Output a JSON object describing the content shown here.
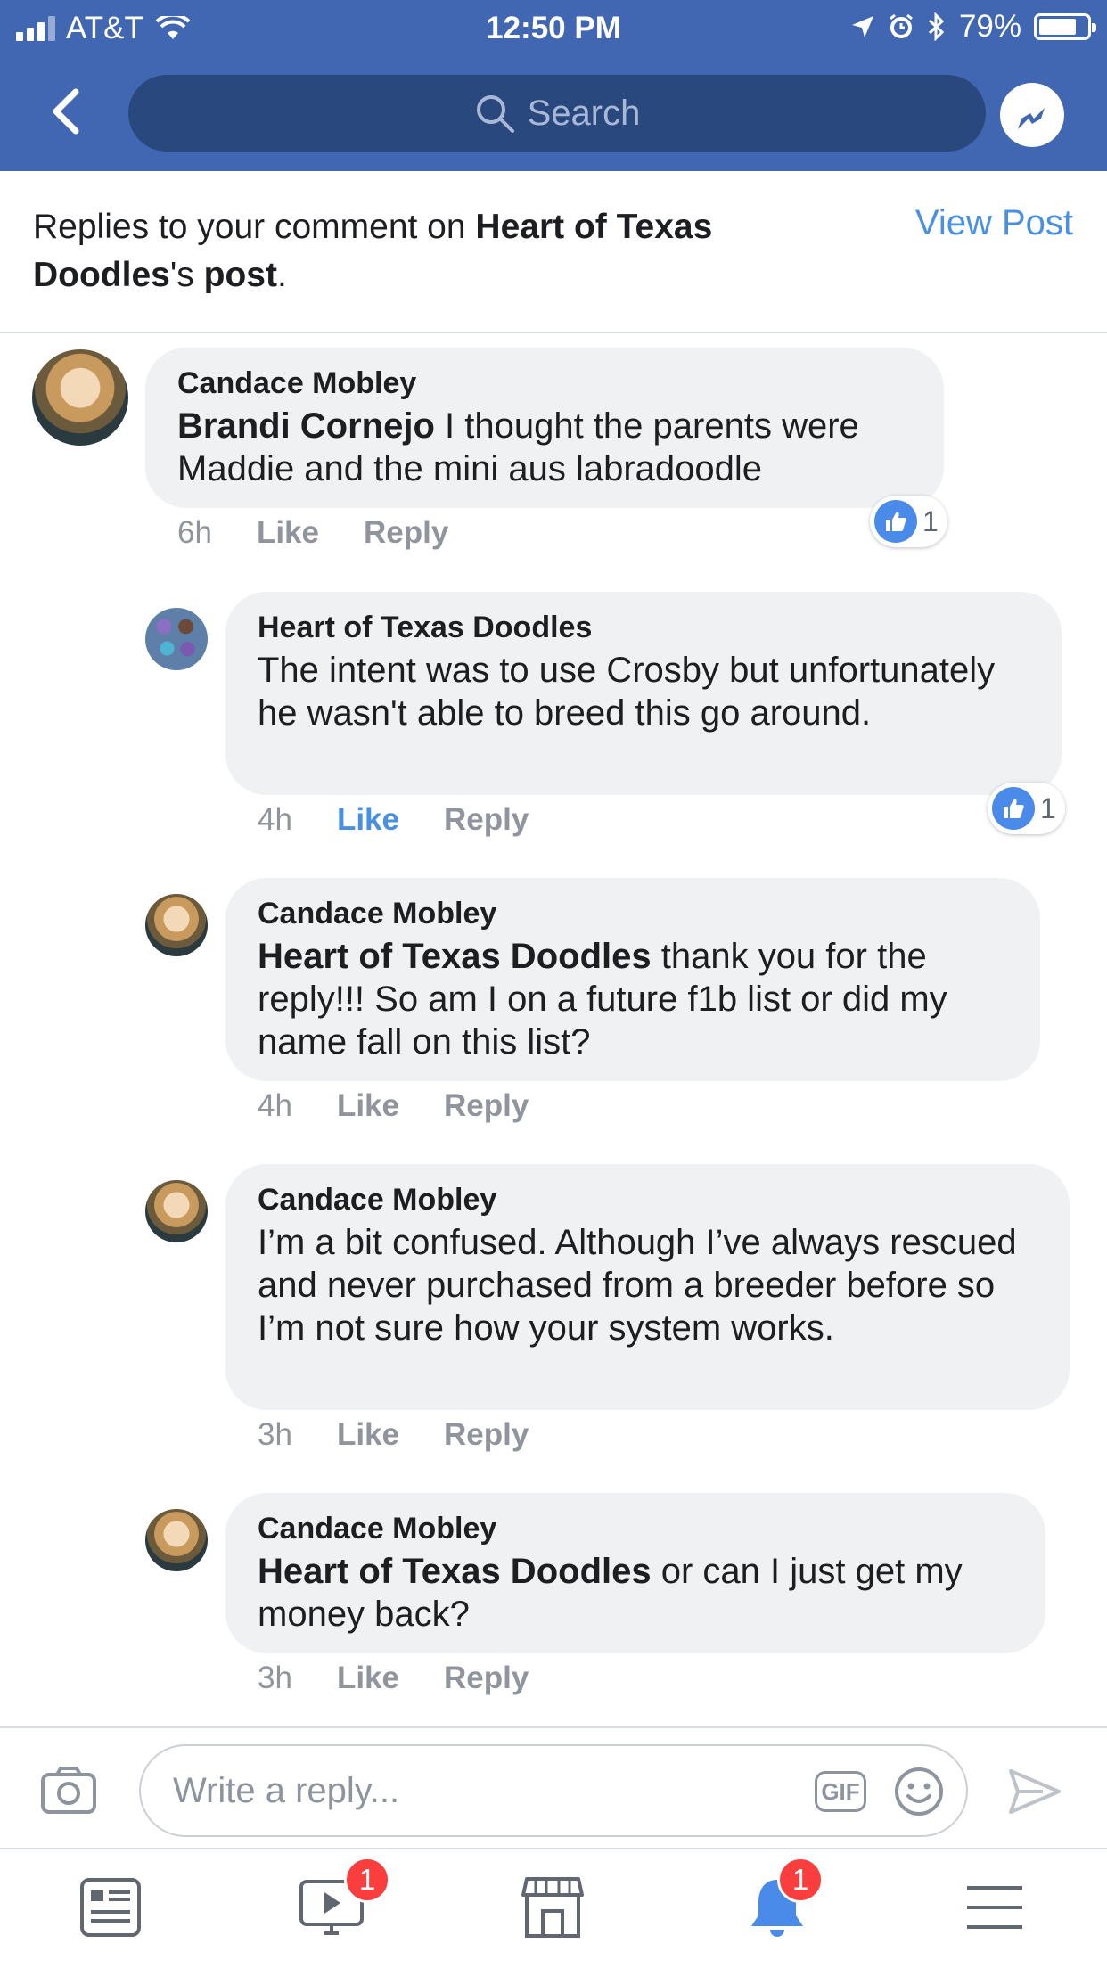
{
  "status_bar": {
    "carrier": "AT&T",
    "time": "12:50 PM",
    "battery_percent": "79%",
    "battery_level": 0.79
  },
  "nav": {
    "search_placeholder": "Search"
  },
  "notice": {
    "prefix": "Replies to your comment on ",
    "page_name": "Heart of Texas Doodles",
    "possessive": "'s ",
    "post_word": "post",
    "period": ".",
    "view_post": "View Post"
  },
  "comments": [
    {
      "author": "Candace Mobley",
      "mention": "Brandi Cornejo",
      "text": " I thought the parents were Maddie and the mini aus labradoodle",
      "time": "6h",
      "like": "Like",
      "reply": "Reply",
      "liked": false,
      "reaction_count": "1"
    },
    {
      "author": "Heart of Texas Doodles",
      "mention": "",
      "text": "The intent was to use Crosby but unfortunately he wasn't able to breed this go around.",
      "time": "4h",
      "like": "Like",
      "reply": "Reply",
      "liked": true,
      "reaction_count": "1"
    },
    {
      "author": "Candace Mobley",
      "mention": "Heart of Texas Doodles",
      "text": " thank you for the reply!!! So am I on a future f1b list or did my name fall on this list?",
      "time": "4h",
      "like": "Like",
      "reply": "Reply",
      "liked": false
    },
    {
      "author": "Candace Mobley",
      "mention": "",
      "text": "I’m a bit confused. Although I’ve  always rescued and never purchased from a breeder before so I’m not sure how your system works.",
      "time": "3h",
      "like": "Like",
      "reply": "Reply",
      "liked": false
    },
    {
      "author": "Candace Mobley",
      "mention": "Heart of Texas Doodles",
      "text": " or can I just get my money back?",
      "time": "3h",
      "like": "Like",
      "reply": "Reply",
      "liked": false
    }
  ],
  "reply_bar": {
    "placeholder": "Write a reply...",
    "gif_label": "GIF"
  },
  "tab_bar": {
    "video_badge": "1",
    "notifications_badge": "1"
  },
  "colors": {
    "header_blue": "#4267b2",
    "search_bg": "#29487d",
    "link_blue": "#4a90e2",
    "bubble_bg": "#eff1f3",
    "badge_red": "#fa3e3e"
  }
}
